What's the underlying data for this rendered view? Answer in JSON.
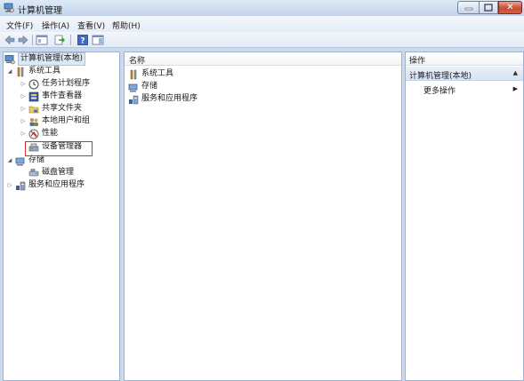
{
  "window": {
    "title": "计算机管理"
  },
  "menu": [
    "文件(F)",
    "操作(A)",
    "查看(V)",
    "帮助(H)"
  ],
  "tree": {
    "root": "计算机管理(本地)",
    "system_tools": "系统工具",
    "task_scheduler": "任务计划程序",
    "event_viewer": "事件查看器",
    "shared_folders": "共享文件夹",
    "local_users": "本地用户和组",
    "performance": "性能",
    "device_manager": "设备管理器",
    "storage": "存储",
    "disk_management": "磁盘管理",
    "services_apps": "服务和应用程序"
  },
  "list": {
    "column_name": "名称",
    "items": [
      "系统工具",
      "存储",
      "服务和应用程序"
    ]
  },
  "actions": {
    "header": "操作",
    "section": "计算机管理(本地)",
    "more": "更多操作"
  },
  "colors": {
    "highlight_box": "#e22a2a",
    "selection": "#dde8f6"
  }
}
